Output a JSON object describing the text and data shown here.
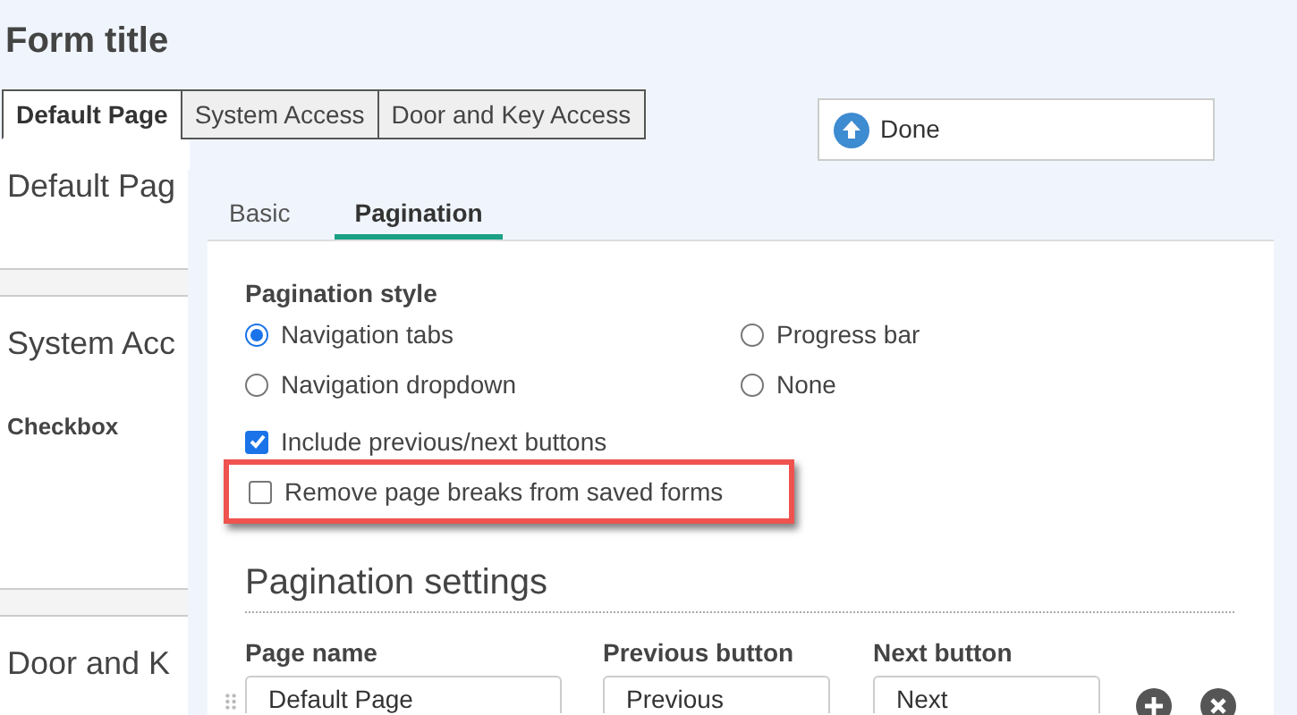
{
  "form_title": "Form title",
  "page_tabs": [
    {
      "label": "Default Page",
      "selected": true
    },
    {
      "label": "System Access",
      "selected": false
    },
    {
      "label": "Door and Key Access",
      "selected": false
    }
  ],
  "done_button": "Done",
  "sections": [
    {
      "heading": "Default Pag"
    },
    {
      "heading": "System Acc",
      "field_label": "Checkbox"
    },
    {
      "heading": "Door and K"
    }
  ],
  "settings_panel": {
    "tabs": [
      {
        "label": "Basic",
        "selected": false
      },
      {
        "label": "Pagination",
        "selected": true
      }
    ],
    "pagination_style": {
      "label": "Pagination style",
      "options": [
        {
          "label": "Navigation tabs",
          "selected": true
        },
        {
          "label": "Progress bar",
          "selected": false
        },
        {
          "label": "Navigation dropdown",
          "selected": false
        },
        {
          "label": "None",
          "selected": false
        }
      ]
    },
    "checkboxes": [
      {
        "label": "Include previous/next buttons",
        "checked": true,
        "highlighted": false
      },
      {
        "label": "Remove page breaks from saved forms",
        "checked": false,
        "highlighted": true
      }
    ],
    "pagination_settings": {
      "title": "Pagination settings",
      "columns": [
        "Page name",
        "Previous button",
        "Next button"
      ],
      "rows": [
        {
          "page_name": "Default Page",
          "previous": "Previous",
          "next": "Next"
        }
      ]
    }
  }
}
